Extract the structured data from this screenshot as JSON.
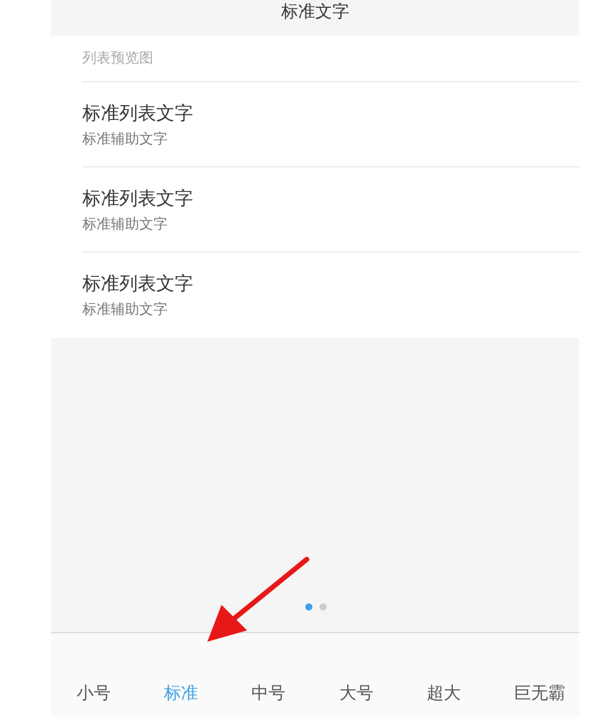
{
  "header": {
    "title": "标准文字"
  },
  "preview": {
    "label": "列表预览图",
    "items": [
      {
        "title": "标准列表文字",
        "subtitle": "标准辅助文字"
      },
      {
        "title": "标准列表文字",
        "subtitle": "标准辅助文字"
      },
      {
        "title": "标准列表文字",
        "subtitle": "标准辅助文字"
      }
    ]
  },
  "pager": [
    {
      "selected": true
    },
    {
      "selected": false
    }
  ],
  "sizes": [
    {
      "label": "小号",
      "selected": false
    },
    {
      "label": "标准",
      "selected": true
    },
    {
      "label": "中号",
      "selected": false
    },
    {
      "label": "大号",
      "selected": false
    },
    {
      "label": "超大",
      "selected": false
    },
    {
      "label": "巨无霸",
      "selected": false
    }
  ]
}
